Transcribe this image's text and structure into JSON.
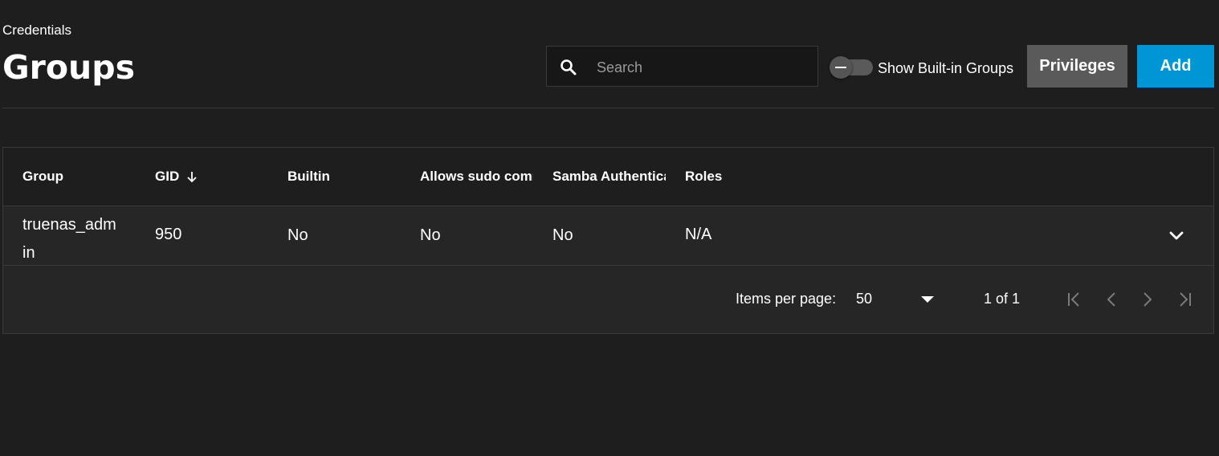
{
  "breadcrumb": "Credentials",
  "page_title": "Groups",
  "search": {
    "placeholder": "Search",
    "value": ""
  },
  "toggle": {
    "label": "Show Built-in Groups",
    "checked": false
  },
  "buttons": {
    "privileges": "Privileges",
    "add": "Add"
  },
  "colors": {
    "accent": "#0095d5",
    "secondary_button": "#5a5a5a",
    "background": "#1e1e1e"
  },
  "table": {
    "columns": [
      "Group",
      "GID",
      "Builtin",
      "Allows sudo comr",
      "Samba Authentica",
      "Roles"
    ],
    "sort": {
      "column": "GID",
      "direction": "descending-icon"
    },
    "rows": [
      {
        "group": "truenas_admin",
        "gid": "950",
        "builtin": "No",
        "sudo": "No",
        "samba": "No",
        "roles": "N/A"
      }
    ]
  },
  "paginator": {
    "items_per_page_label": "Items per page:",
    "items_per_page": "50",
    "range": "1 of 1"
  }
}
